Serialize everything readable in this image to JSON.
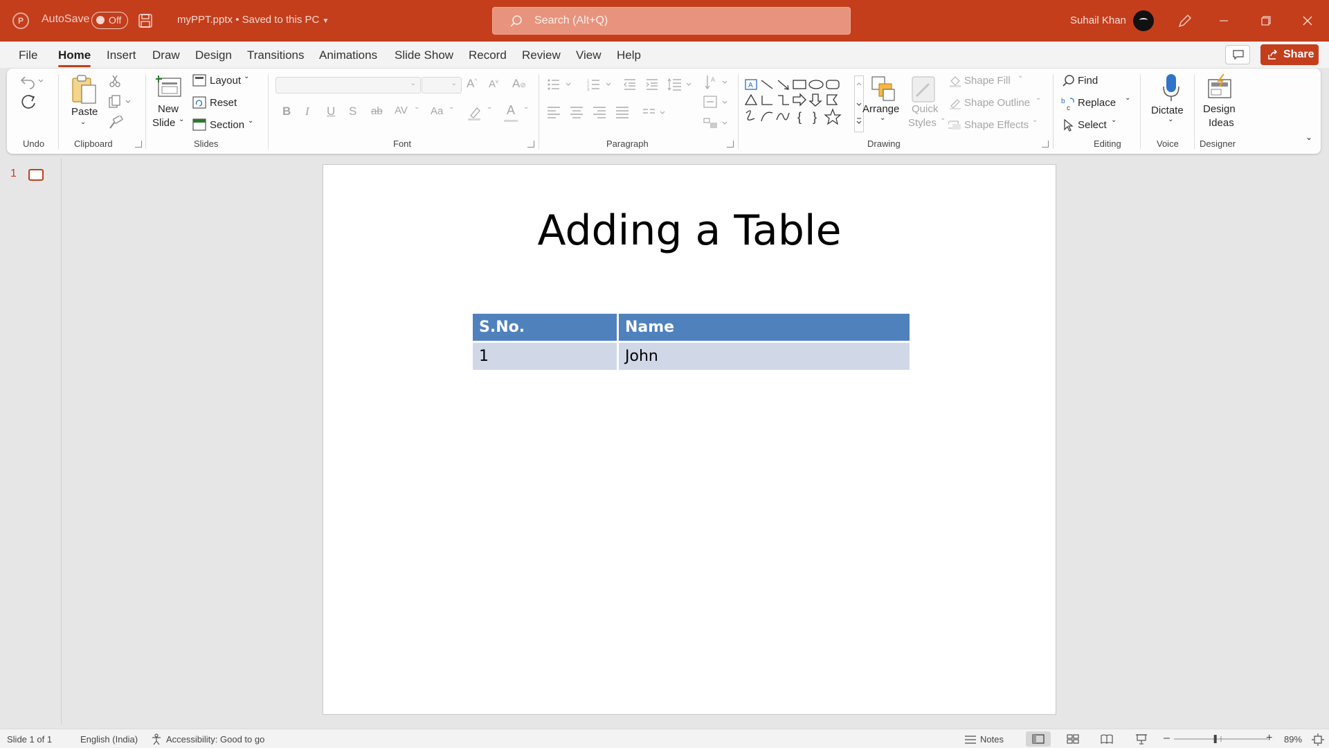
{
  "titlebar": {
    "autosave_label": "AutoSave",
    "autosave_state": "Off",
    "filename": "myPPT.pptx • Saved to this PC",
    "search_placeholder": "Search (Alt+Q)",
    "user_name": "Suhail Khan",
    "brand_color": "#c43e1c"
  },
  "tabs": [
    "File",
    "Home",
    "Insert",
    "Draw",
    "Design",
    "Transitions",
    "Animations",
    "Slide Show",
    "Record",
    "Review",
    "View",
    "Help"
  ],
  "active_tab": "Home",
  "share_label": "Share",
  "ribbon": {
    "groups": {
      "undo": "Undo",
      "clipboard": "Clipboard",
      "slides": "Slides",
      "font": "Font",
      "paragraph": "Paragraph",
      "drawing": "Drawing",
      "editing": "Editing",
      "voice": "Voice",
      "designer": "Designer"
    },
    "paste": "Paste",
    "new_slide_1": "New",
    "new_slide_2": "Slide",
    "layout": "Layout",
    "reset": "Reset",
    "section": "Section",
    "arrange": "Arrange",
    "quick_styles_1": "Quick",
    "quick_styles_2": "Styles",
    "shape_fill": "Shape Fill",
    "shape_outline": "Shape Outline",
    "shape_effects": "Shape Effects",
    "find": "Find",
    "replace": "Replace",
    "select": "Select",
    "dictate": "Dictate",
    "design_ideas_1": "Design",
    "design_ideas_2": "Ideas",
    "bold": "B",
    "italic": "I",
    "underline": "U",
    "shadow": "S",
    "strike": "ab",
    "spacing": "AV",
    "case": "Aa",
    "font_color": "A"
  },
  "thumbnail": {
    "number": "1"
  },
  "slide": {
    "title": "Adding a Table",
    "table": {
      "headers": [
        "S.No.",
        "Name"
      ],
      "rows": [
        [
          "1",
          "John"
        ]
      ]
    }
  },
  "status": {
    "slide": "Slide 1 of 1",
    "language": "English (India)",
    "accessibility": "Accessibility: Good to go",
    "notes": "Notes",
    "zoom": "89%",
    "zoom_percent": 89
  }
}
